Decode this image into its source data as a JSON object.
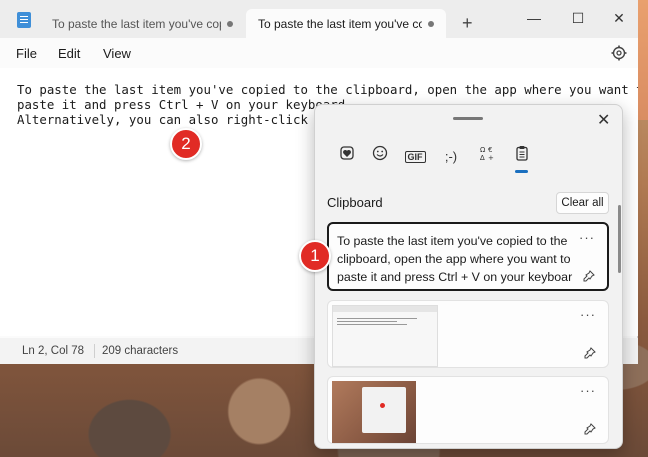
{
  "titlebar": {
    "tabs": [
      {
        "label": "To paste the last item you've copie",
        "active": false
      },
      {
        "label": "To paste the last item you've copie",
        "active": true
      }
    ],
    "new_tab_glyph": "+",
    "window_controls": {
      "minimize": "—",
      "maximize": "☐",
      "close": "✕"
    }
  },
  "menu": {
    "items": [
      "File",
      "Edit",
      "View"
    ],
    "settings_icon": "gear-icon"
  },
  "editor": {
    "text": "To paste the last item you've copied to the clipboard, open the app where you want to\npaste it and press Ctrl + V on your keyboard\nAlternatively, you can also right-click and"
  },
  "status": {
    "position": "Ln 2, Col 78",
    "characters": "209 characters"
  },
  "markers": [
    "1",
    "2"
  ],
  "flyout": {
    "close_glyph": "✕",
    "tabs": [
      {
        "icon": "heart-emoji-icon"
      },
      {
        "icon": "smiley-icon"
      },
      {
        "icon": "gif-icon",
        "label": "GIF"
      },
      {
        "icon": "kaomoji-icon",
        "label": ";-)"
      },
      {
        "icon": "symbols-icon"
      },
      {
        "icon": "clipboard-icon"
      }
    ],
    "section_title": "Clipboard",
    "clear_all_label": "Clear all",
    "items": [
      {
        "type": "text",
        "text": "To paste the last item you've copied to the clipboard, open the app where you want to paste it and press Ctrl + V on your keyboar",
        "more": "···"
      },
      {
        "type": "image",
        "more": "···"
      },
      {
        "type": "image",
        "more": "···"
      }
    ]
  },
  "colors": {
    "accent": "#1a6fbf",
    "marker": "#e12b25"
  }
}
